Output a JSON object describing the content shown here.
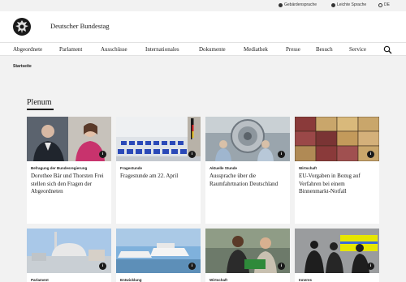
{
  "topbar": {
    "sign_language": "Gebärdensprache",
    "easy_language": "Leichte Sprache",
    "language": "DE"
  },
  "header": {
    "title": "Deutscher Bundestag"
  },
  "nav": {
    "items": [
      "Abgeordnete",
      "Parlament",
      "Ausschüsse",
      "Internationales",
      "Dokumente",
      "Mediathek",
      "Presse",
      "Besuch",
      "Service"
    ]
  },
  "breadcrumb": "Startseite",
  "section": {
    "title": "Plenum"
  },
  "cards": [
    {
      "category": "Befragung der Bundesregierung",
      "headline": "Dorothee Bär und Thorsten Frei stellen sich den Fragen der Abgeordneten"
    },
    {
      "category": "Fragestunde",
      "headline": "Fragestunde am 22. April"
    },
    {
      "category": "Aktuelle Stunde",
      "headline": "Aussprache über die Raumfahrtnation Deutschland"
    },
    {
      "category": "Wirtschaft",
      "headline": "EU-Vorgaben in Bezug auf Verfahren bei einem Binnenmarkt-Notfall"
    },
    {
      "category": "Parlament",
      "headline": ""
    },
    {
      "category": "Entwicklung",
      "headline": ""
    },
    {
      "category": "Wirtschaft",
      "headline": ""
    },
    {
      "category": "Inneres",
      "headline": ""
    }
  ],
  "icons": {
    "info": "i",
    "search": "search-icon",
    "logo": "federal-eagle-logo"
  },
  "colors": {
    "page_bg": "#f2f2f2",
    "card_bg": "#ffffff",
    "text": "#1a1a1a"
  }
}
